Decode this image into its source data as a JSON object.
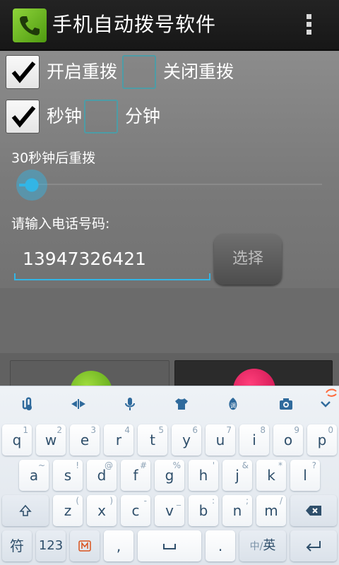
{
  "app": {
    "title": "手机自动拨号软件"
  },
  "options": {
    "redial_on_label": "开启重拨",
    "redial_off_label": "关闭重拨",
    "seconds_label": "秒钟",
    "minutes_label": "分钟"
  },
  "delay": {
    "text": "30秒钟后重拨"
  },
  "phone": {
    "label": "请输入电话号码:",
    "value": "13947326421",
    "select_button": "选择"
  },
  "keyboard": {
    "toolbar_icons": [
      "paperclip-icon",
      "cursor-move-icon",
      "microphone-icon",
      "shirt-icon",
      "emoji-icon",
      "camera-icon",
      "chevron-down-icon"
    ],
    "row1": [
      {
        "main": "q",
        "sub": "1"
      },
      {
        "main": "w",
        "sub": "2"
      },
      {
        "main": "e",
        "sub": "3"
      },
      {
        "main": "r",
        "sub": "4"
      },
      {
        "main": "t",
        "sub": "5"
      },
      {
        "main": "y",
        "sub": "6"
      },
      {
        "main": "u",
        "sub": "7"
      },
      {
        "main": "i",
        "sub": "8"
      },
      {
        "main": "o",
        "sub": "9"
      },
      {
        "main": "p",
        "sub": "0"
      }
    ],
    "row2": [
      {
        "main": "a",
        "sub": "~"
      },
      {
        "main": "s",
        "sub": "!"
      },
      {
        "main": "d",
        "sub": "@"
      },
      {
        "main": "f",
        "sub": "#"
      },
      {
        "main": "g",
        "sub": "%"
      },
      {
        "main": "h",
        "sub": "'"
      },
      {
        "main": "j",
        "sub": "&"
      },
      {
        "main": "k",
        "sub": "*"
      },
      {
        "main": "l",
        "sub": "?"
      }
    ],
    "row3": [
      {
        "main": "z",
        "sub": "("
      },
      {
        "main": "x",
        "sub": ")"
      },
      {
        "main": "c",
        "sub": "-"
      },
      {
        "main": "v",
        "sub": "_"
      },
      {
        "main": "b",
        "sub": ":"
      },
      {
        "main": "n",
        "sub": ";"
      },
      {
        "main": "m",
        "sub": "/"
      }
    ],
    "row4": {
      "symbol": "符",
      "numbers": "123",
      "comma": ",",
      "period": ".",
      "lang_zh": "中/",
      "lang_en": "英"
    }
  },
  "colors": {
    "accent": "#33b5e5",
    "action_bar": "#1c1c1c",
    "key_text": "#2f4f6b"
  }
}
